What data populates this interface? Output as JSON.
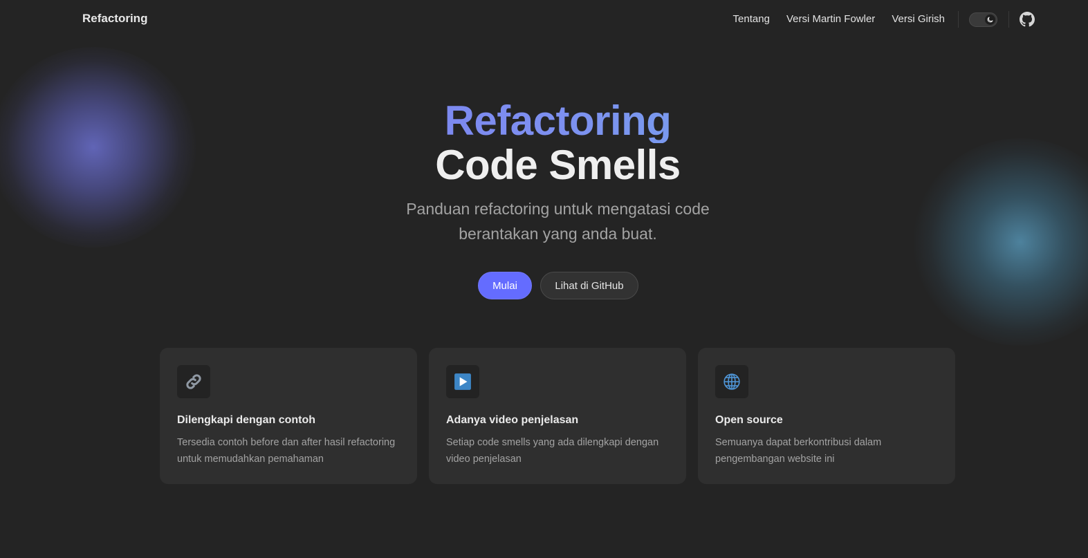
{
  "nav": {
    "brand": "Refactoring",
    "links": [
      "Tentang",
      "Versi Martin Fowler",
      "Versi Girish"
    ],
    "theme_toggle_icon": "moon-icon",
    "github_icon": "github-icon"
  },
  "hero": {
    "title_accent": "Refactoring",
    "title_main": "Code Smells",
    "tagline": "Panduan refactoring untuk mengatasi code berantakan yang anda buat.",
    "primary_button": "Mulai",
    "secondary_button": "Lihat di GitHub"
  },
  "features": [
    {
      "icon": "link-icon",
      "title": "Dilengkapi dengan contoh",
      "details": "Tersedia contoh before dan after hasil refactoring untuk memudahkan pemahaman"
    },
    {
      "icon": "play-button-icon",
      "title": "Adanya video penjelasan",
      "details": "Setiap code smells yang ada dilengkapi dengan video penjelasan"
    },
    {
      "icon": "globe-icon",
      "title": "Open source",
      "details": "Semuanya dapat berkontribusi dalam pengembangan website ini"
    }
  ],
  "colors": {
    "background": "#242424",
    "brand": "#646cff",
    "card": "#2f2f2f"
  }
}
